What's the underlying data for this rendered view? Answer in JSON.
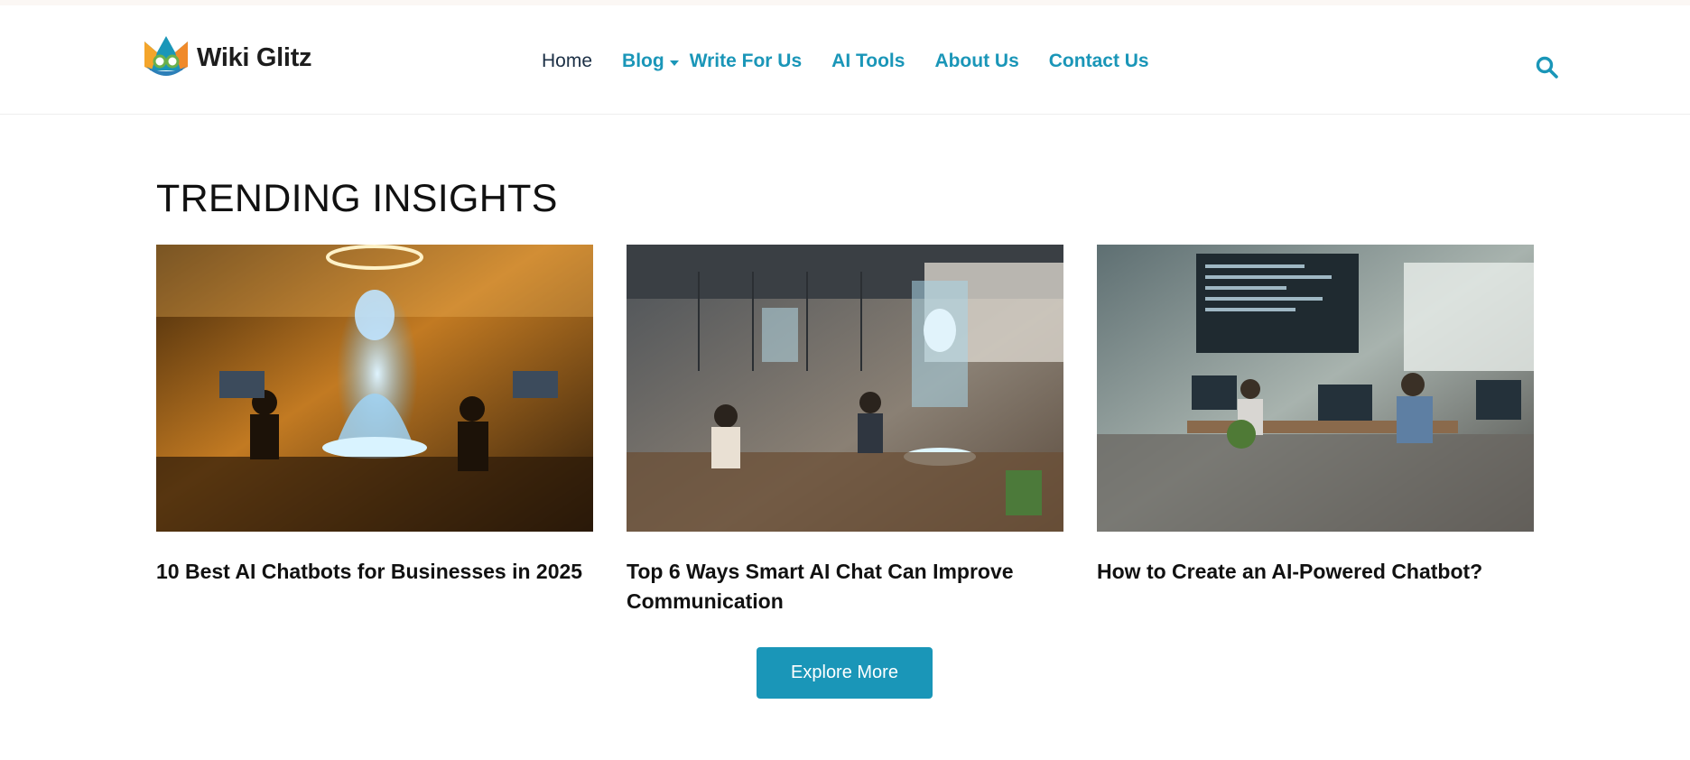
{
  "brand": {
    "name": "Wiki Glitz",
    "accent": "#1a96b8"
  },
  "nav": {
    "items": [
      {
        "label": "Home"
      },
      {
        "label": "Blog"
      },
      {
        "label": "Write For Us"
      },
      {
        "label": "AI Tools"
      },
      {
        "label": "About Us"
      },
      {
        "label": "Contact Us"
      }
    ]
  },
  "icons": {
    "search": "search-icon",
    "dropdown": "chevron-down-icon"
  },
  "section": {
    "title": "TRENDING INSIGHTS"
  },
  "posts": [
    {
      "title": "10 Best AI Chatbots for Businesses in 2025"
    },
    {
      "title": "Top 6 Ways Smart AI Chat Can Improve Communication"
    },
    {
      "title": "How to Create an AI-Powered Chatbot?"
    }
  ],
  "cta": {
    "label": "Explore More"
  }
}
